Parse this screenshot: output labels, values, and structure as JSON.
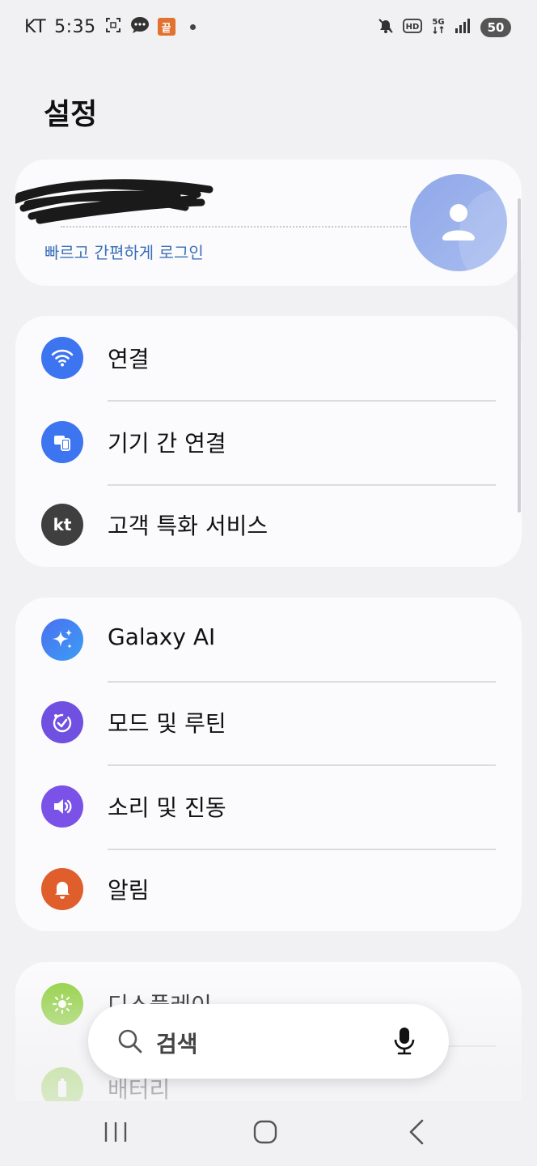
{
  "status_bar": {
    "carrier": "KT",
    "time": "5:35",
    "app_badge": "끝",
    "battery": "50",
    "icons": [
      "screenshot-icon",
      "chat-bubble-icon",
      "app-badge-icon",
      "notification-dot",
      "mute-icon",
      "hd-voice-icon",
      "5g-icon",
      "signal-icon",
      "battery-icon"
    ]
  },
  "header": {
    "title": "설정"
  },
  "account": {
    "login_text": "빠르고 간편하게 로그인",
    "avatar_icon": "person-icon"
  },
  "group1": [
    {
      "label": "연결",
      "icon": "wifi-icon",
      "color": "#3d74f0"
    },
    {
      "label": "기기 간 연결",
      "icon": "devices-icon",
      "color": "#3d74f0"
    },
    {
      "label": "고객 특화 서비스",
      "icon": "kt-logo-icon",
      "color": "#3f3f3f"
    }
  ],
  "group2": [
    {
      "label": "Galaxy AI",
      "icon": "sparkle-icon",
      "color": "#4b6ff0"
    },
    {
      "label": "모드 및 루틴",
      "icon": "routine-check-icon",
      "color": "#7050e0"
    },
    {
      "label": "소리 및 진동",
      "icon": "speaker-icon",
      "color": "#7a52e8"
    },
    {
      "label": "알림",
      "icon": "bell-icon",
      "color": "#e05d2c"
    }
  ],
  "group3": [
    {
      "label": "디스플레이",
      "icon": "brightness-icon",
      "color": "#8fd03c"
    },
    {
      "label": "배터리",
      "icon": "battery-item-icon",
      "color": "#8fd03c"
    }
  ],
  "search": {
    "label": "검색"
  },
  "nav": [
    "recents-button",
    "home-button",
    "back-button"
  ]
}
